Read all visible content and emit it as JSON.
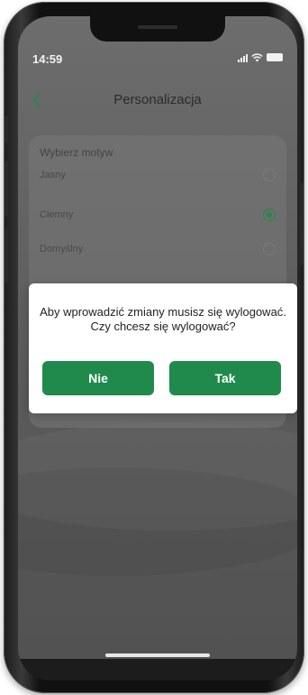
{
  "status": {
    "time": "14:59"
  },
  "header": {
    "title": "Personalizacja",
    "back_icon": "chevron-left-icon"
  },
  "theme": {
    "heading": "Wybierz motyw",
    "options": [
      {
        "label": "Jasny",
        "selected": false
      },
      {
        "label": "Ciemny",
        "selected": true
      },
      {
        "label": "Domyślny",
        "selected": false
      }
    ]
  },
  "dialog": {
    "message": "Aby wprowadzić zmiany musisz się wylogować. Czy chcesz się wylogować?",
    "no_label": "Nie",
    "yes_label": "Tak"
  },
  "colors": {
    "accent": "#1f8a4c",
    "overlay": "#5f5f5f"
  }
}
